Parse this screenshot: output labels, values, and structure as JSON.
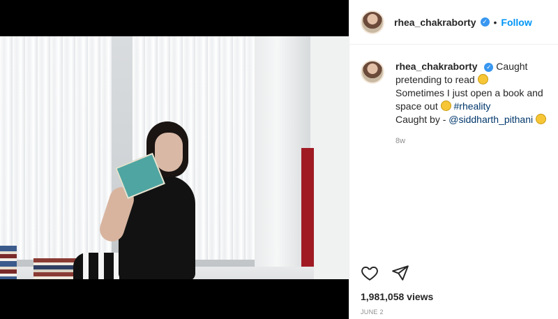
{
  "post": {
    "author": "rhea_chakraborty",
    "follow_label": "Follow",
    "separator": "•",
    "caption": {
      "line1": "Caught pretending to read",
      "line2": "Sometimes I just open a book and space out",
      "hashtag": "#rheality",
      "line3_prefix": "Caught by - ",
      "mention": "@siddharth_pithani"
    },
    "age": "8w",
    "views": "1,981,058 views",
    "date": "JUNE 2"
  },
  "icons": {
    "verified": "verified-badge-icon",
    "like": "heart-icon",
    "share": "paper-plane-icon"
  },
  "colors": {
    "accent": "#0095f6",
    "verified": "#3897f0",
    "text": "#262626",
    "muted": "#8e8e8e",
    "hashtag": "#00376b"
  }
}
